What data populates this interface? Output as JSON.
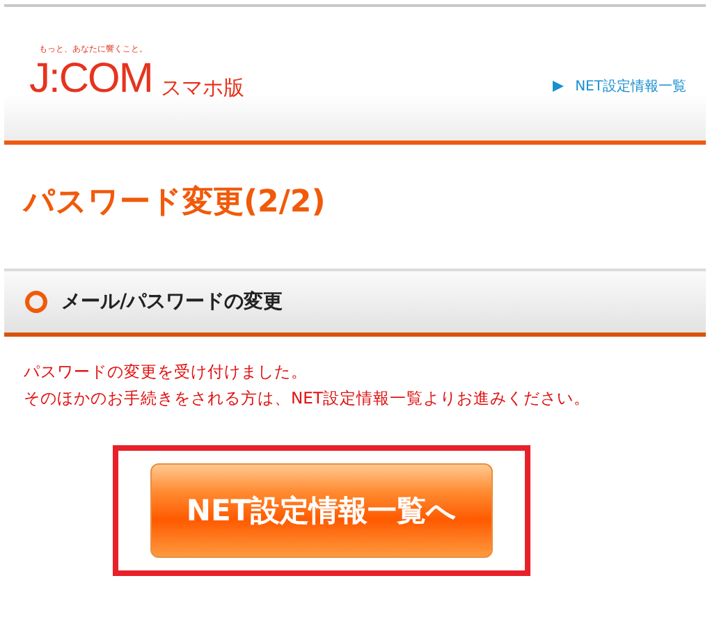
{
  "header": {
    "tagline": "もっと、あなたに響くこと。",
    "logo": "J:COM",
    "logo_suffix": "スマホ版",
    "nav_link": "NET設定情報一覧"
  },
  "page_title": "パスワード変更(2/2)",
  "section": {
    "title": "メール/パスワードの変更"
  },
  "messages": [
    "パスワードの変更を受け付けました。",
    "そのほかのお手続きをされる方は、NET設定情報一覧よりお進みください。"
  ],
  "button": {
    "label": "NET設定情報一覧へ",
    "highlighted": true
  }
}
